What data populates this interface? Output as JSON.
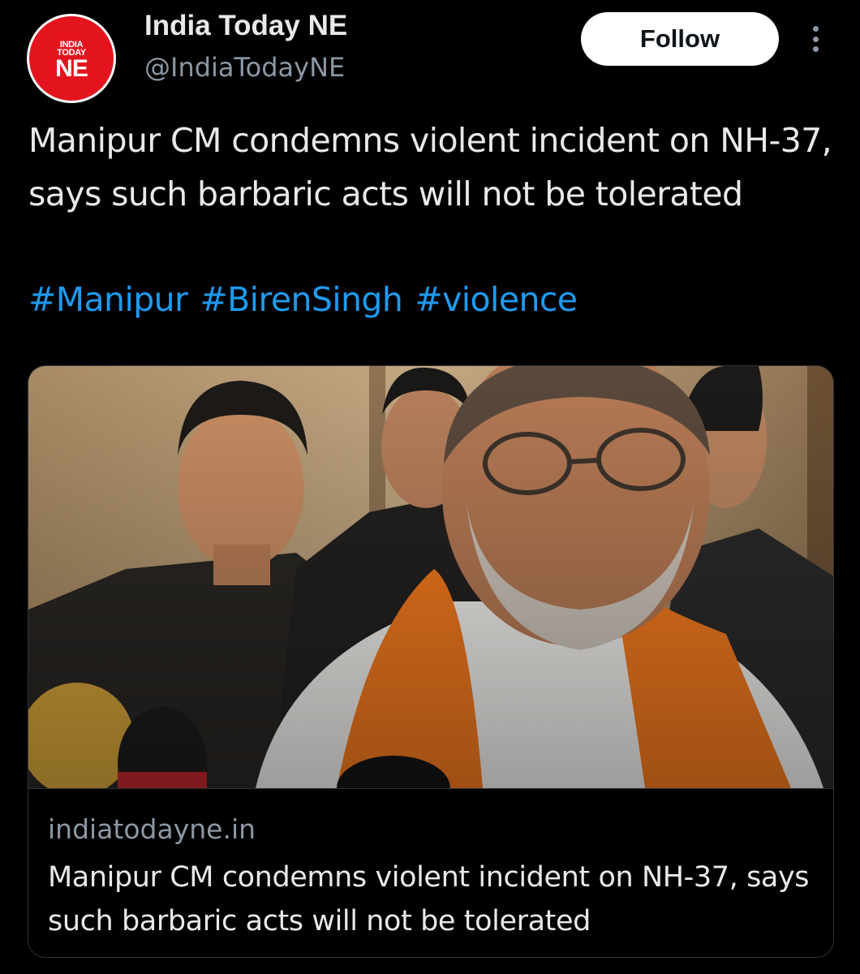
{
  "account": {
    "display_name": "India Today NE",
    "handle": "@IndiaTodayNE",
    "avatar_logo_small": "INDIA\nTODAY",
    "avatar_logo_big": "NE",
    "brand_color": "#e4141f"
  },
  "actions": {
    "follow_label": "Follow",
    "more_icon": "more-vertical-icon"
  },
  "tweet": {
    "text": "Manipur CM condemns violent incident on NH-37, says such barbaric acts will not be tolerated",
    "hashtags": [
      "#Manipur",
      "#BirenSingh",
      "#violence"
    ]
  },
  "link_card": {
    "domain": "indiatodayne.in",
    "title": "Manipur CM condemns violent incident on NH-37, says such barbaric acts will not be tolerated"
  },
  "colors": {
    "background": "#000000",
    "text_primary": "#e7e9ea",
    "text_secondary": "#8b98a5",
    "link": "#1d9bf0",
    "border": "#2f3336"
  }
}
